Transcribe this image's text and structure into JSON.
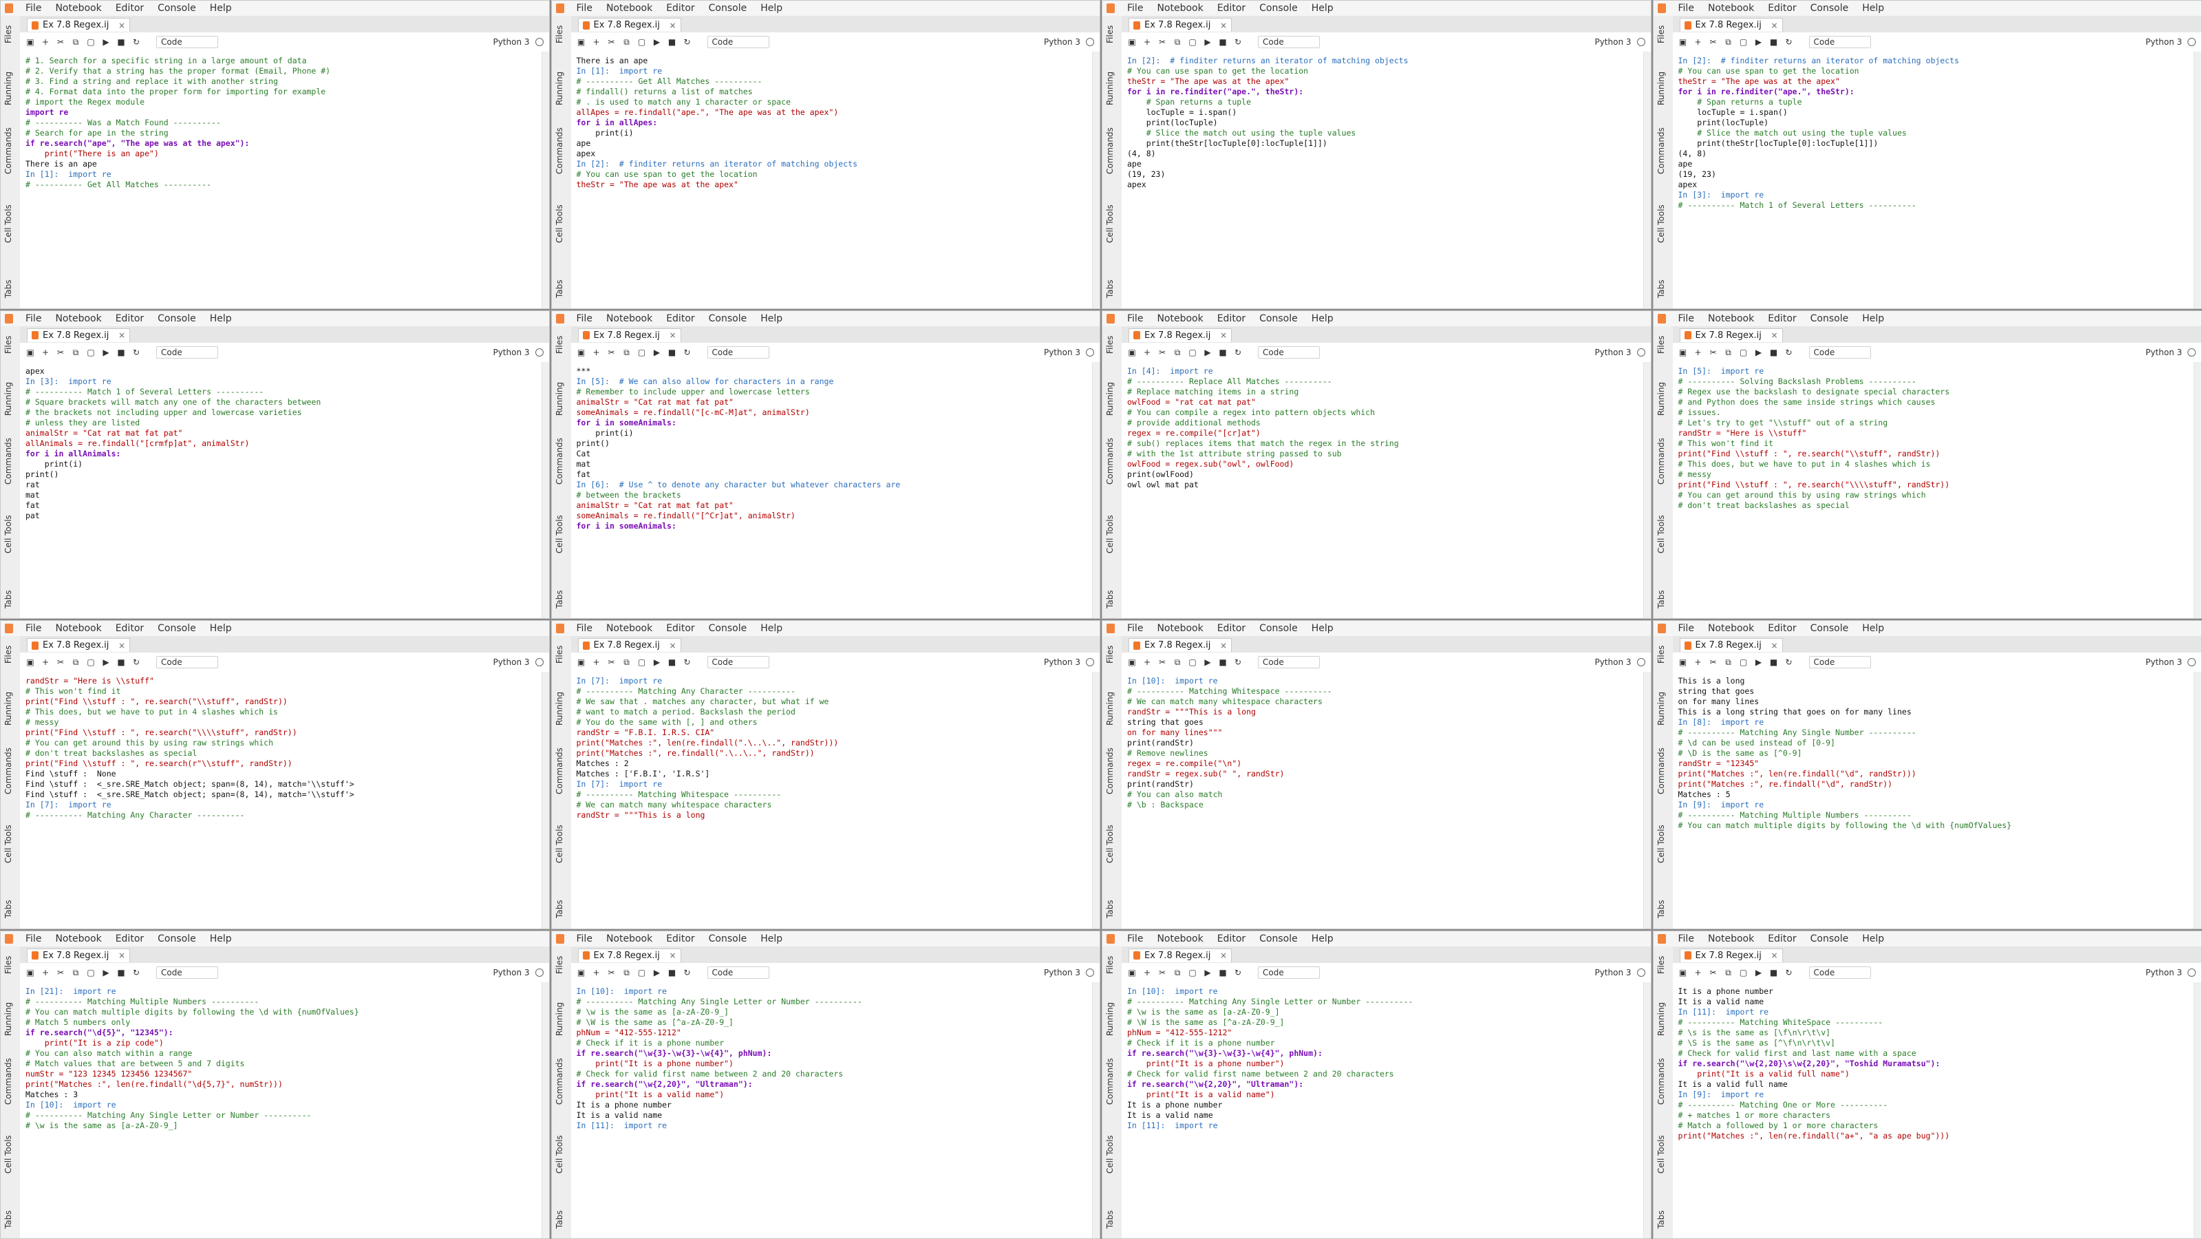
{
  "app": {
    "menus": [
      "File",
      "Notebook",
      "Editor",
      "Console",
      "Help"
    ],
    "left_tabs": [
      "Files",
      "Running",
      "Commands",
      "Cell Tools",
      "Tabs"
    ],
    "tab_title": "Ex 7.8 Regex.ij",
    "cell_type": "Code",
    "kernel": "Python 3",
    "colors": {
      "accent": "#2a6ebc",
      "comment": "#2b7d2b",
      "keyword": "#7a0fb5",
      "string": "#b00000"
    }
  },
  "panels": [
    {
      "id": "p1",
      "lines": [
        "# 1. Search for a specific string in a large amount of data",
        "# 2. Verify that a string has the proper format (Email, Phone #)",
        "# 3. Find a string and replace it with another string",
        "# 4. Format data into the proper form for importing for example",
        "",
        "# import the Regex module",
        "import re",
        "",
        "# ---------- Was a Match Found ----------",
        "",
        "# Search for ape in the string",
        "if re.search(\"ape\", \"The ape was at the apex\"):",
        "    print(\"There is an ape\")",
        "",
        "There is an ape",
        "",
        "In [1]:  import re",
        "# ---------- Get All Matches ----------"
      ]
    },
    {
      "id": "p2",
      "lines": [
        "There is an ape",
        "",
        "In [1]:  import re",
        "# ---------- Get All Matches ----------",
        "",
        "# findall() returns a list of matches",
        "# . is used to match any 1 character or space",
        "allApes = re.findall(\"ape.\", \"The ape was at the apex\")",
        "",
        "for i in allApes:",
        "    print(i)",
        "",
        "ape",
        "apex",
        "",
        "In [2]:  # finditer returns an iterator of matching objects",
        "# You can use span to get the location",
        "",
        "theStr = \"The ape was at the apex\""
      ]
    },
    {
      "id": "p3",
      "lines": [
        "In [2]:  # finditer returns an iterator of matching objects",
        "# You can use span to get the location",
        "",
        "theStr = \"The ape was at the apex\"",
        "",
        "for i in re.finditer(\"ape.\", theStr):",
        "",
        "    # Span returns a tuple",
        "    locTuple = i.span()",
        "",
        "    print(locTuple)",
        "",
        "    # Slice the match out using the tuple values",
        "    print(theStr[locTuple[0]:locTuple[1]])",
        "",
        "(4, 8)",
        "ape",
        "(19, 23)",
        "apex"
      ]
    },
    {
      "id": "p4",
      "lines": [
        "In [2]:  # finditer returns an iterator of matching objects",
        "# You can use span to get the location",
        "",
        "theStr = \"The ape was at the apex\"",
        "",
        "for i in re.finditer(\"ape.\", theStr):",
        "",
        "    # Span returns a tuple",
        "    locTuple = i.span()",
        "",
        "    print(locTuple)",
        "",
        "    # Slice the match out using the tuple values",
        "    print(theStr[locTuple[0]:locTuple[1]])",
        "",
        "(4, 8)",
        "ape",
        "(19, 23)",
        "apex",
        "",
        "In [3]:  import re",
        "# ---------- Match 1 of Several Letters ----------"
      ]
    },
    {
      "id": "p5",
      "lines": [
        "apex",
        "",
        "In [3]:  import re",
        "# ---------- Match 1 of Several Letters ----------",
        "",
        "# Square brackets will match any one of the characters between",
        "# the brackets not including upper and lowercase varieties",
        "# unless they are listed",
        "",
        "animalStr = \"Cat rat mat fat pat\"",
        "",
        "allAnimals = re.findall(\"[crmfp]at\", animalStr)",
        "for i in allAnimals:",
        "    print(i)",
        "",
        "print()",
        "",
        "rat",
        "mat",
        "fat",
        "pat"
      ]
    },
    {
      "id": "p6",
      "lines": [
        "***",
        "",
        "In [5]:  # We can also allow for characters in a range",
        "# Remember to include upper and lowercase letters",
        "animalStr = \"Cat rat mat fat pat\"",
        "someAnimals = re.findall(\"[c-mC-M]at\", animalStr)",
        "for i in someAnimals:",
        "    print(i)",
        "",
        "print()",
        "",
        "Cat",
        "mat",
        "fat",
        "",
        "In [6]:  # Use ^ to denote any character but whatever characters are",
        "# between the brackets",
        "animalStr = \"Cat rat mat fat pat\"",
        "someAnimals = re.findall(\"[^Cr]at\", animalStr)",
        "for i in someAnimals:"
      ]
    },
    {
      "id": "p7",
      "lines": [
        "In [4]:  import re",
        "# ---------- Replace All Matches ----------",
        "",
        "# Replace matching items in a string",
        "",
        "owlFood = \"rat cat mat pat\"",
        "",
        "# You can compile a regex into pattern objects which",
        "# provide additional methods",
        "regex = re.compile(\"[cr]at\")",
        "",
        "# sub() replaces items that match the regex in the string",
        "# with the 1st attribute string passed to sub",
        "owlFood = regex.sub(\"owl\", owlFood)",
        "",
        "print(owlFood)",
        "",
        "owl owl mat pat"
      ]
    },
    {
      "id": "p8",
      "lines": [
        "In [5]:  import re",
        "# ---------- Solving Backslash Problems ----------",
        "",
        "# Regex use the backslash to designate special characters",
        "# and Python does the same inside strings which causes",
        "# issues.",
        "",
        "# Let's try to get \"\\\\stuff\" out of a string",
        "",
        "randStr = \"Here is \\\\stuff\"",
        "",
        "# This won't find it",
        "print(\"Find \\\\stuff : \", re.search(\"\\\\stuff\", randStr))",
        "",
        "# This does, but we have to put in 4 slashes which is",
        "# messy",
        "print(\"Find \\\\stuff : \", re.search(\"\\\\\\\\stuff\", randStr))",
        "",
        "# You can get around this by using raw strings which",
        "# don't treat backslashes as special"
      ]
    },
    {
      "id": "p9",
      "lines": [
        "randStr = \"Here is \\\\stuff\"",
        "",
        "# This won't find it",
        "print(\"Find \\\\stuff : \", re.search(\"\\\\stuff\", randStr))",
        "",
        "# This does, but we have to put in 4 slashes which is",
        "# messy",
        "print(\"Find \\\\stuff : \", re.search(\"\\\\\\\\stuff\", randStr))",
        "",
        "# You can get around this by using raw strings which",
        "# don't treat backslashes as special",
        "print(\"Find \\\\stuff : \", re.search(r\"\\\\stuff\", randStr))",
        "",
        "Find \\stuff :  None",
        "Find \\stuff :  <_sre.SRE_Match object; span=(8, 14), match='\\\\stuff'>",
        "Find \\stuff :  <_sre.SRE_Match object; span=(8, 14), match='\\\\stuff'>",
        "",
        "In [7]:  import re",
        "# ---------- Matching Any Character ----------"
      ]
    },
    {
      "id": "p10",
      "lines": [
        "In [7]:  import re",
        "# ---------- Matching Any Character ----------",
        "# We saw that . matches any character, but what if we",
        "# want to match a period. Backslash the period",
        "# You do the same with [, ] and others",
        "",
        "randStr = \"F.B.I. I.R.S. CIA\"",
        "",
        "print(\"Matches :\", len(re.findall(\".\\..\\..\", randStr)))",
        "print(\"Matches :\", re.findall(\".\\..\\..\", randStr))",
        "",
        "Matches : 2",
        "Matches : ['F.B.I', 'I.R.S']",
        "",
        "In [7]:  import re",
        "# ---------- Matching Whitespace ----------",
        "# We can match many whitespace characters",
        "",
        "randStr = \"\"\"This is a long"
      ]
    },
    {
      "id": "p11",
      "lines": [
        "In [10]:  import re",
        "# ---------- Matching Whitespace ----------",
        "# We can match many whitespace characters",
        "",
        "randStr = \"\"\"This is a long",
        "string that goes",
        "on for many lines\"\"\"",
        "",
        "print(randStr)",
        "",
        "# Remove newlines",
        "regex = re.compile(\"\\n\")",
        "",
        "randStr = regex.sub(\" \", randStr)",
        "",
        "print(randStr)",
        "",
        "# You can also match",
        "# \\b : Backspace"
      ]
    },
    {
      "id": "p12",
      "lines": [
        "This is a long",
        "string that goes",
        "on for many lines",
        "This is a long string that goes on for many lines",
        "",
        "In [8]:  import re",
        "# ---------- Matching Any Single Number ----------",
        "# \\d can be used instead of [0-9]",
        "# \\D is the same as [^0-9]",
        "",
        "randStr = \"12345\"",
        "",
        "print(\"Matches :\", len(re.findall(\"\\d\", randStr)))",
        "print(\"Matches :\", re.findall(\"\\d\", randStr))",
        "",
        "Matches : 5",
        "",
        "In [9]:  import re",
        "# ---------- Matching Multiple Numbers ----------",
        "# You can match multiple digits by following the \\d with {numOfValues}"
      ]
    },
    {
      "id": "p13",
      "lines": [
        "In [21]:  import re",
        "# ---------- Matching Multiple Numbers ----------",
        "# You can match multiple digits by following the \\d with {numOfValues}",
        "",
        "# Match 5 numbers only",
        "if re.search(\"\\d{5}\", \"12345\"):",
        "    print(\"It is a zip code\")",
        "",
        "# You can also match within a range",
        "# Match values that are between 5 and 7 digits",
        "numStr = \"123 12345 123456 1234567\"",
        "",
        "print(\"Matches :\", len(re.findall(\"\\d{5,7}\", numStr)))",
        "",
        "Matches : 3",
        "",
        "In [10]:  import re",
        "# ---------- Matching Any Single Letter or Number ----------",
        "# \\w is the same as [a-zA-Z0-9_]"
      ]
    },
    {
      "id": "p14",
      "lines": [
        "In [10]:  import re",
        "# ---------- Matching Any Single Letter or Number ----------",
        "# \\w is the same as [a-zA-Z0-9_]",
        "# \\W is the same as [^a-zA-Z0-9_]",
        "",
        "phNum = \"412-555-1212\"",
        "",
        "# Check if it is a phone number",
        "if re.search(\"\\w{3}-\\w{3}-\\w{4}\", phNum):",
        "    print(\"It is a phone number\")",
        "",
        "# Check for valid first name between 2 and 20 characters",
        "if re.search(\"\\w{2,20}\", \"Ultraman\"):",
        "    print(\"It is a valid name\")",
        "",
        "It is a phone number",
        "It is a valid name",
        "",
        "In [11]:  import re"
      ]
    },
    {
      "id": "p15",
      "lines": [
        "In [10]:  import re",
        "# ---------- Matching Any Single Letter or Number ----------",
        "# \\w is the same as [a-zA-Z0-9_]",
        "# \\W is the same as [^a-zA-Z0-9_]",
        "",
        "phNum = \"412-555-1212\"",
        "",
        "# Check if it is a phone number",
        "if re.search(\"\\w{3}-\\w{3}-\\w{4}\", phNum):",
        "    print(\"It is a phone number\")",
        "",
        "# Check for valid first name between 2 and 20 characters",
        "if re.search(\"\\w{2,20}\", \"Ultraman\"):",
        "    print(\"It is a valid name\")",
        "",
        "It is a phone number",
        "It is a valid name",
        "",
        "In [11]:  import re"
      ]
    },
    {
      "id": "p16",
      "lines": [
        "It is a phone number",
        "It is a valid name",
        "",
        "In [11]:  import re",
        "# ---------- Matching WhiteSpace ----------",
        "# \\s is the same as [\\f\\n\\r\\t\\v]",
        "# \\S is the same as [^\\f\\n\\r\\t\\v]",
        "",
        "# Check for valid first and last name with a space",
        "if re.search(\"\\w{2,20}\\s\\w{2,20}\", \"Toshid Muramatsu\"):",
        "    print(\"It is a valid full name\")",
        "",
        "It is a valid full name",
        "",
        "In [9]:  import re",
        "# ---------- Matching One or More ----------",
        "# + matches 1 or more characters",
        "",
        "# Match a followed by 1 or more characters",
        "print(\"Matches :\", len(re.findall(\"a+\", \"a as ape bug\")))"
      ]
    }
  ]
}
